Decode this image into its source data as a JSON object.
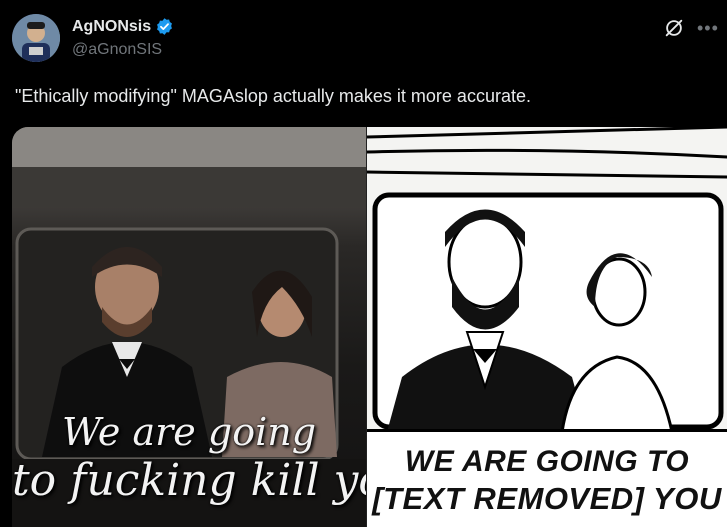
{
  "author": {
    "display_name": "AgNONsis",
    "handle": "@aGnonSIS",
    "verified": true
  },
  "tweet": {
    "text": "\"Ethically modifying\" MAGAslop actually makes it more accurate."
  },
  "media": {
    "left_image": {
      "overlay_line1": "We are going",
      "overlay_line2": "to fucking kill you"
    },
    "right_image": {
      "caption_line1": "WE ARE GOING TO",
      "caption_line2": "[TEXT REMOVED] YOU"
    }
  },
  "icons": {
    "verified": "verified-badge-icon",
    "grok": "grok-icon",
    "more": "more-options-icon"
  },
  "colors": {
    "background": "#000000",
    "text_primary": "#e7e9ea",
    "text_secondary": "#71767b",
    "verified_blue": "#1d9bf0"
  }
}
